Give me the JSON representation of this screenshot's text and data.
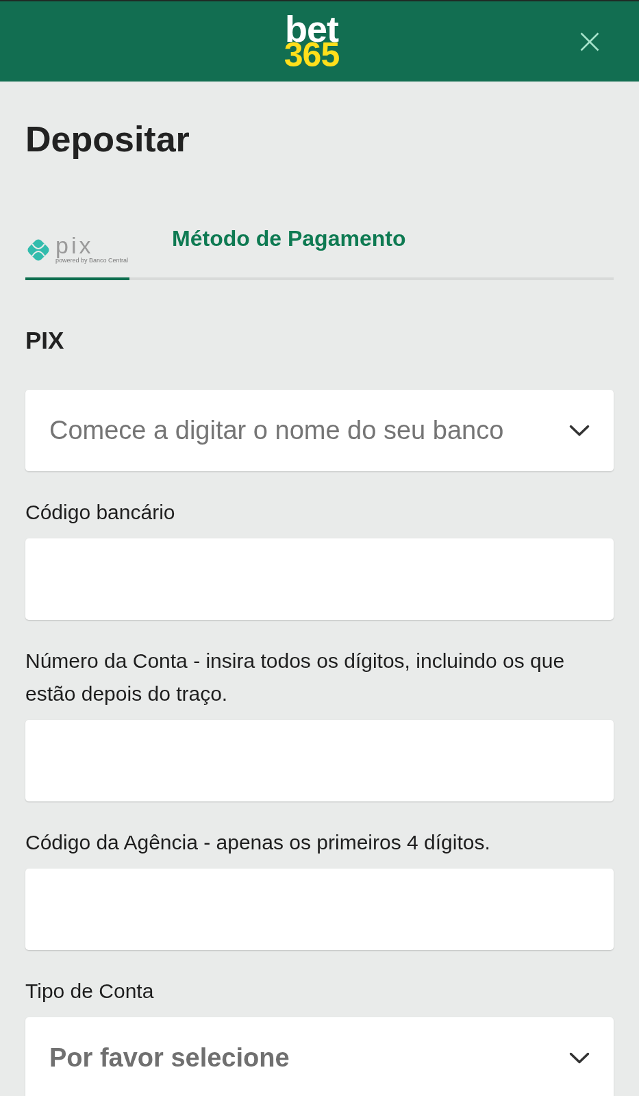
{
  "header": {
    "logo": {
      "word": "bet",
      "number": "365"
    }
  },
  "page": {
    "title": "Depositar"
  },
  "payment_methods": {
    "options": [
      {
        "name": "pix",
        "caption": "powered by Banco Central",
        "selected": true
      }
    ],
    "label": "Método de Pagamento"
  },
  "form": {
    "title": "PIX",
    "fields": [
      {
        "kind": "combobox",
        "placeholder": "Comece a digitar o nome do seu banco"
      },
      {
        "kind": "text",
        "label": "Código bancário"
      },
      {
        "kind": "text",
        "label": "Número da Conta - insira todos os dígitos, incluindo os que estão depois do traço."
      },
      {
        "kind": "text",
        "label": "Código da Agência - apenas os primeiros 4 dígitos."
      },
      {
        "kind": "select",
        "label": "Tipo de Conta",
        "placeholder": "Por favor selecione"
      }
    ]
  }
}
